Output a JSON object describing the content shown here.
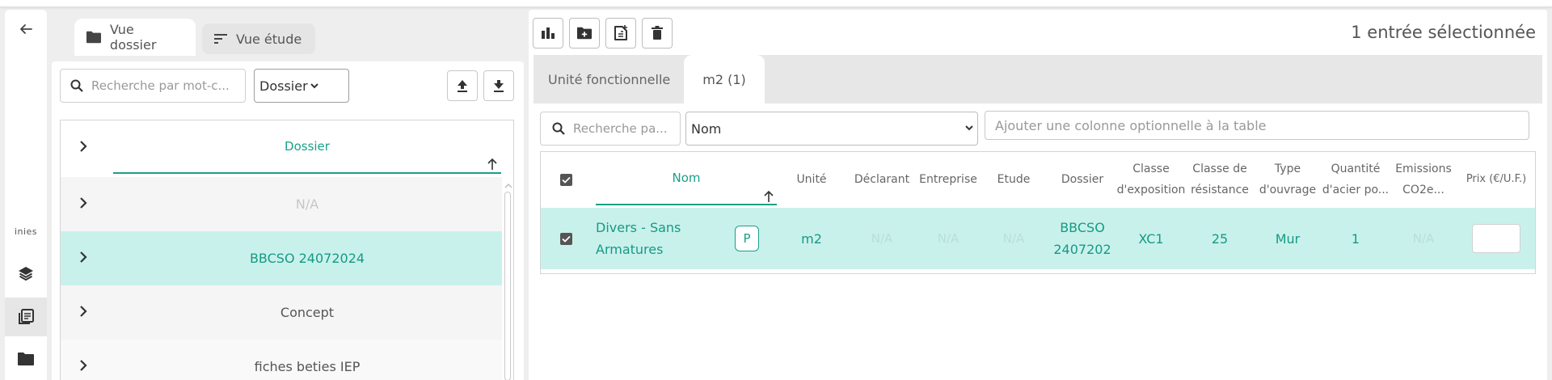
{
  "icons": {
    "back": "arrow-left-icon",
    "layers": "layers-icon",
    "library": "library-icon",
    "folder": "folder-icon"
  },
  "rail": {
    "inies_label": "inies"
  },
  "left": {
    "tabs": {
      "dossier": "Vue dossier",
      "etude": "Vue étude"
    },
    "search_placeholder": "Recherche par mot-c...",
    "filter_value": "Dossier",
    "tree_header": "Dossier",
    "rows": [
      "N/A",
      "BBCSO 24072024",
      "Concept",
      "fiches beties IEP"
    ]
  },
  "right": {
    "selection_count": "1 entrée sélectionnée",
    "tabs": [
      "Unité fonctionnelle",
      "m2 (1)"
    ],
    "search_placeholder": "Recherche pa...",
    "column_select": "Nom",
    "add_column_placeholder": "Ajouter une colonne optionnelle à la table",
    "columns": {
      "nom": "Nom",
      "unite": "Unité",
      "declarant": "Déclarant",
      "entreprise": "Entreprise",
      "etude": "Etude",
      "dossier": "Dossier",
      "exposition_1": "Classe",
      "exposition_2": "d'exposition",
      "resistance_1": "Classe de",
      "resistance_2": "résistance",
      "ouvrage_1": "Type",
      "ouvrage_2": "d'ouvrage",
      "acier_1": "Quantité",
      "acier_2": "d'acier po...",
      "emissions_1": "Emissions",
      "emissions_2": "CO2e...",
      "prix": "Prix (€/U.F.)"
    },
    "row": {
      "nom_1": "Divers - Sans",
      "nom_2": "Armatures",
      "badge": "P",
      "unite": "m2",
      "declarant": "N/A",
      "entreprise": "N/A",
      "etude": "N/A",
      "dossier_1": "BBCSO",
      "dossier_2": "2407202",
      "exposition": "XC1",
      "resistance": "25",
      "ouvrage": "Mur",
      "acier": "1",
      "emissions": "N/A",
      "prix": ""
    }
  }
}
